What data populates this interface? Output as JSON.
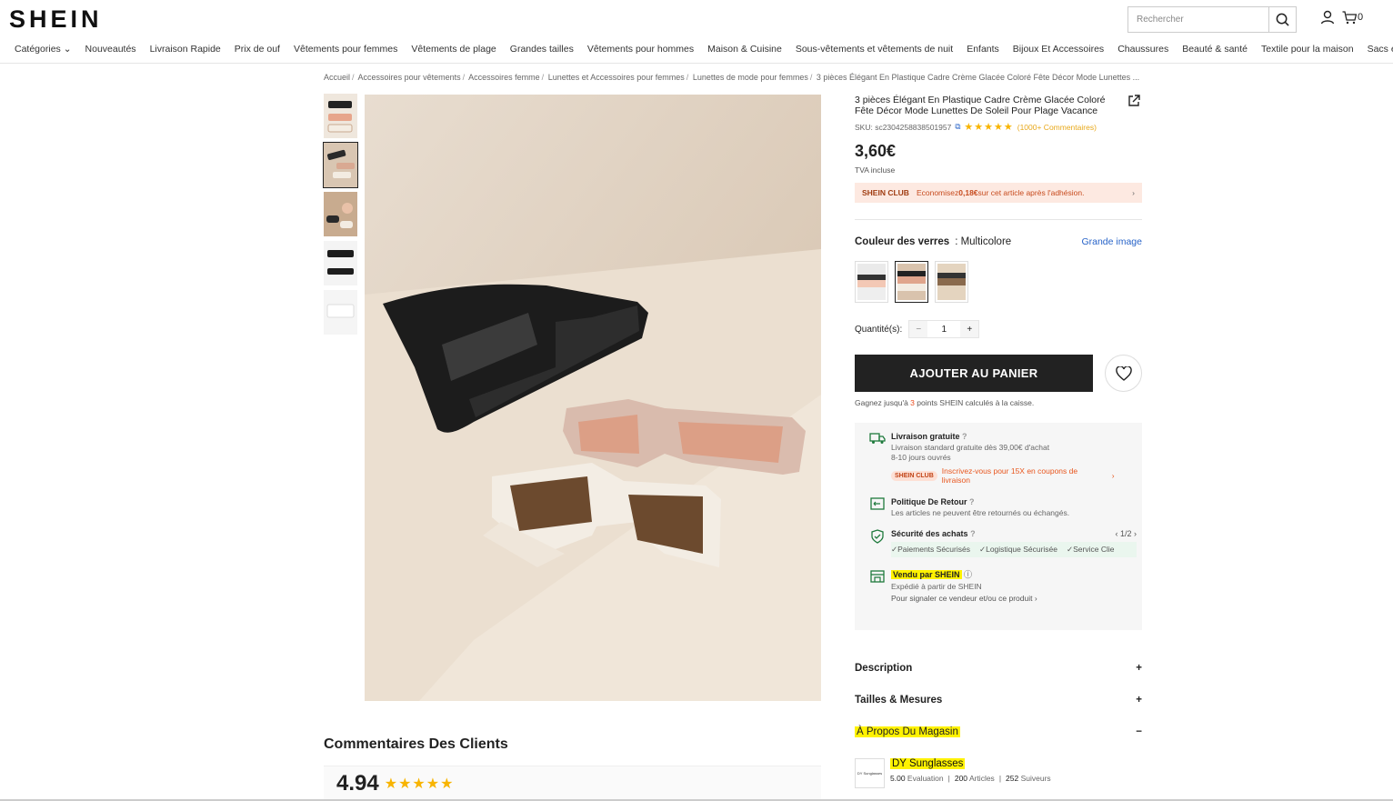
{
  "brand": "SHEIN",
  "search": {
    "placeholder": "Rechercher"
  },
  "cart_count": "0",
  "nav": [
    "Catégories",
    "Nouveautés",
    "Livraison Rapide",
    "Prix de ouf",
    "Vêtements pour femmes",
    "Vêtements de plage",
    "Grandes tailles",
    "Vêtements pour hommes",
    "Maison & Cuisine",
    "Sous-vêtements et vêtements de nuit",
    "Enfants",
    "Bijoux Et Accessoires",
    "Chaussures",
    "Beauté & santé",
    "Textile pour la maison",
    "Sacs et bagages"
  ],
  "breadcrumb": [
    "Accueil",
    "Accessoires pour vêtements",
    "Accessoires femme",
    "Lunettes et Accessoires pour femmes",
    "Lunettes de mode pour femmes",
    "3 pièces Élégant En Plastique Cadre Crème Glacée Coloré Fête Décor Mode Lunettes ..."
  ],
  "product": {
    "title": "3 pièces Élégant En Plastique Cadre Crème Glacée Coloré Fête Décor Mode Lunettes De Soleil Pour Plage Vacance",
    "sku": "SKU: sc2304258838501957",
    "stars": "★★★★★",
    "reviews_count": "(1000+ Commentaires)",
    "price": "3,60€",
    "vat": "TVA incluse",
    "club_label": "SHEIN CLUB",
    "club_text_pre": "Economisez ",
    "club_amount": "0,18€",
    "club_text_post": " sur cet article après l'adhésion.",
    "color_label": "Couleur des verres",
    "color_value": ": Multicolore",
    "big_image": "Grande image",
    "qty_label": "Quantité(s):",
    "qty_minus": "−",
    "qty_value": "1",
    "qty_plus": "+",
    "add_to_cart": "AJOUTER AU PANIER",
    "points_pre": "Gagnez jusqu'à ",
    "points_num": "3",
    "points_post": " points SHEIN calculés à la caisse."
  },
  "shipping": {
    "free_title": "Livraison gratuite",
    "free_desc1": "Livraison standard gratuite dès 39,00€ d'achat",
    "free_desc2": "8-10 jours ouvrés",
    "club_tag": "SHEIN CLUB",
    "club_offer": "Inscrivez-vous pour 15X en coupons de livraison",
    "return_title": "Politique De Retour",
    "return_desc": "Les articles ne peuvent être retournés ou échangés.",
    "security_title": "Sécurité des achats",
    "security_page": "1/2",
    "checks": [
      "Paiements Sécurisés",
      "Logistique Sécurisée",
      "Service Clie"
    ],
    "seller_title": "Vendu par SHEIN",
    "seller_desc": "Expédié à partir de SHEIN",
    "report": "Pour signaler ce vendeur et/ou ce produit"
  },
  "accordion": {
    "description": "Description",
    "sizes": "Tailles & Mesures",
    "store": "À Propos Du Magasin",
    "plus": "+",
    "minus": "−"
  },
  "store": {
    "logo_text": "DY Sunglasses",
    "name": "DY Sunglasses",
    "rating": "5.00",
    "rating_label": "Evaluation",
    "articles": "200",
    "articles_label": "Articles",
    "followers": "252",
    "followers_label": "Suiveurs"
  },
  "reviews": {
    "title": "Commentaires Des Clients",
    "score": "4.94",
    "stars": "★★★★★"
  },
  "colors": {
    "highlight": "#fff200",
    "club_bg": "#fde9e1",
    "link": "#2763c8"
  }
}
